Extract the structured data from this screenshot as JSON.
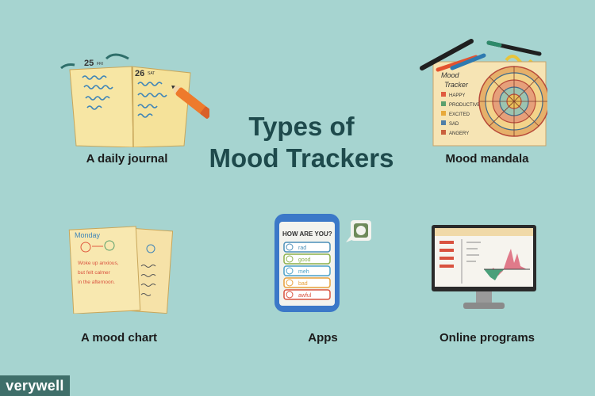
{
  "title_line1": "Types of",
  "title_line2": "Mood Trackers",
  "items": [
    {
      "label": "A daily journal"
    },
    {
      "label": "Mood mandala"
    },
    {
      "label": "A mood chart"
    },
    {
      "label": "Apps"
    },
    {
      "label": "Online programs"
    }
  ],
  "journal": {
    "day_left": "25",
    "dow_left": "FRI",
    "day_right": "26",
    "dow_right": "SAT"
  },
  "mandala": {
    "heading1": "Mood",
    "heading2": "Tracker",
    "legend": [
      {
        "text": "HAPPY",
        "color": "#e05a3f"
      },
      {
        "text": "PRODUCTIVE",
        "color": "#5ba06c"
      },
      {
        "text": "EXCITED",
        "color": "#e8a93a"
      },
      {
        "text": "SAD",
        "color": "#4f7fa8"
      },
      {
        "text": "ANGERY",
        "color": "#c9603d"
      }
    ]
  },
  "mood_chart": {
    "day": "Monday",
    "note1": "Woke up anxious,",
    "note2": "but felt calmer",
    "note3": "in the afternoon."
  },
  "app": {
    "question": "HOW ARE YOU?",
    "options": [
      {
        "text": "rad",
        "color": "#4a8fb8"
      },
      {
        "text": "good",
        "color": "#8cb04a"
      },
      {
        "text": "meh",
        "color": "#4aa0c8"
      },
      {
        "text": "bad",
        "color": "#e8a03a"
      },
      {
        "text": "awful",
        "color": "#d9523f"
      }
    ]
  },
  "brand": "verywell",
  "colors": {
    "background": "#a6d4d0",
    "title": "#1e4a4c",
    "brand_bg": "#3f6f6a"
  }
}
